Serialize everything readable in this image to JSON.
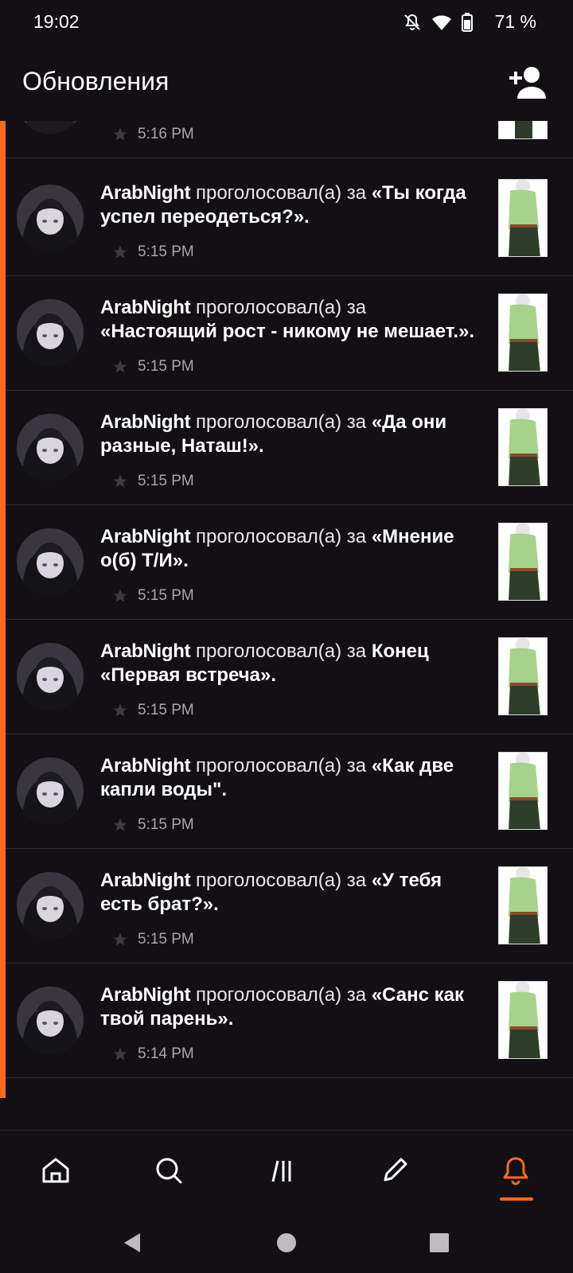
{
  "status_bar": {
    "time": "19:02",
    "battery_percent": "71 %",
    "icons": [
      "mute-bell-icon",
      "wifi-icon",
      "battery-icon"
    ]
  },
  "header": {
    "title": "Обновления",
    "action_icon": "add-user-icon"
  },
  "colors": {
    "accent": "#ff6a1a",
    "background": "#121014",
    "divider": "#2e2b31",
    "meta_text": "#a8a6ab"
  },
  "feed": {
    "partial_top_time": "5:16 PM",
    "items": [
      {
        "user": "ArabNight",
        "verb": "проголосовал(а) за",
        "title": "«Ты когда успел переодеться?».",
        "time": "5:15 PM"
      },
      {
        "user": "ArabNight",
        "verb": "проголосовал(а) за",
        "title": "«Настоящий рост - никому не мешает.».",
        "time": "5:15 PM"
      },
      {
        "user": "ArabNight",
        "verb": "проголосовал(а) за",
        "title": "«Да они разные, Наташ!».",
        "time": "5:15 PM"
      },
      {
        "user": "ArabNight",
        "verb": "проголосовал(а) за",
        "title": "«Мнение о(б) Т/И».",
        "time": "5:15 PM"
      },
      {
        "user": "ArabNight",
        "verb": "проголосовал(а) за",
        "title": "Конец «Первая встреча».",
        "time": "5:15 PM"
      },
      {
        "user": "ArabNight",
        "verb": "проголосовал(а) за",
        "title": "«Как две капли воды\".",
        "time": "5:15 PM"
      },
      {
        "user": "ArabNight",
        "verb": "проголосовал(а) за",
        "title": "«У тебя есть брат?».",
        "time": "5:15 PM"
      },
      {
        "user": "ArabNight",
        "verb": "проголосовал(а) за",
        "title": "«Санс как твой парень».",
        "time": "5:14 PM"
      }
    ]
  },
  "bottom_nav": {
    "items": [
      {
        "icon": "home-icon"
      },
      {
        "icon": "search-icon"
      },
      {
        "icon": "library-icon"
      },
      {
        "icon": "pencil-icon"
      },
      {
        "icon": "bell-icon",
        "active": true
      }
    ]
  },
  "system_nav": [
    "back-icon",
    "home-circle-icon",
    "recents-icon"
  ]
}
